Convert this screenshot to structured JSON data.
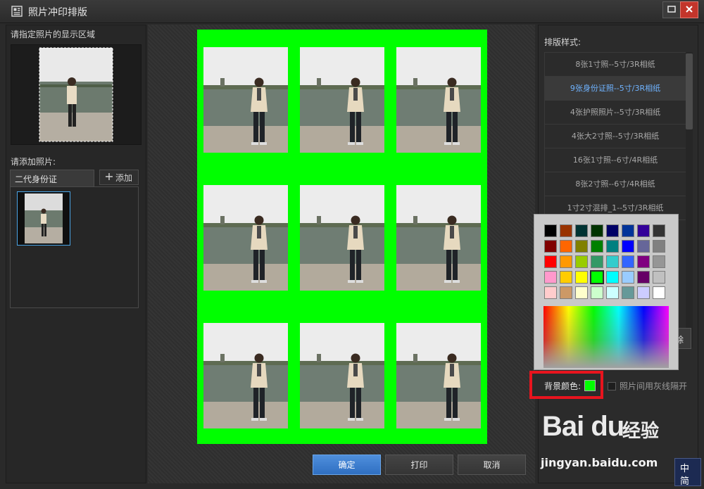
{
  "window": {
    "title": "照片冲印排版",
    "icon": "photo-layout-icon",
    "controls": {
      "maximize_icon": "maximize-icon",
      "close_icon": "close-icon"
    }
  },
  "left_panel": {
    "display_area_label": "请指定照片的显示区域",
    "add_photo_label": "请添加照片:",
    "tab_label": "二代身份证",
    "add_button_label": "添加",
    "add_button_icon": "plus-icon"
  },
  "center": {
    "sheet_background_color": "#00ff00",
    "grid": {
      "rows": 3,
      "cols": 3
    },
    "buttons": {
      "confirm": "确定",
      "print": "打印",
      "cancel": "取消"
    }
  },
  "right_panel": {
    "layout_style_label": "排版样式:",
    "layouts": [
      "8张1寸照--5寸/3R相纸",
      "9张身份证照--5寸/3R相纸",
      "4张护照照片--5寸/3R相纸",
      "4张大2寸照--5寸/3R相纸",
      "16张1寸照--6寸/4R相纸",
      "8张2寸照--6寸/4R相纸",
      "1寸2寸混排_1--5寸/3R相纸"
    ],
    "selected_layout_index": 1,
    "partial_button_label": "除",
    "background_color_label": "背景颜色:",
    "background_color_value": "#00ff00",
    "gray_line_checkbox_label": "照片间用灰线隔开",
    "gray_line_checked": false
  },
  "color_picker": {
    "swatches": [
      "#000000",
      "#993300",
      "#003333",
      "#003300",
      "#000066",
      "#003399",
      "#330099",
      "#333333",
      "#800000",
      "#ff6600",
      "#808000",
      "#008000",
      "#008080",
      "#0000ff",
      "#666699",
      "#808080",
      "#ff0000",
      "#ff9900",
      "#99cc00",
      "#339966",
      "#33cccc",
      "#3366ff",
      "#800080",
      "#969696",
      "#ff99cc",
      "#ffcc00",
      "#ffff00",
      "#00ff00",
      "#00ffff",
      "#99ccff",
      "#660066",
      "#c0c0c0",
      "#ffcccc",
      "#cc9966",
      "#ffffcc",
      "#ccffcc",
      "#ccffff",
      "#669999",
      "#ccccff",
      "#ffffff"
    ],
    "selected_swatch_index": 27
  },
  "watermark": {
    "logo": "Bai du",
    "cn": "经验",
    "url": "jingyan.baidu.com"
  },
  "ime": {
    "line1": "中",
    "line2": "简"
  }
}
